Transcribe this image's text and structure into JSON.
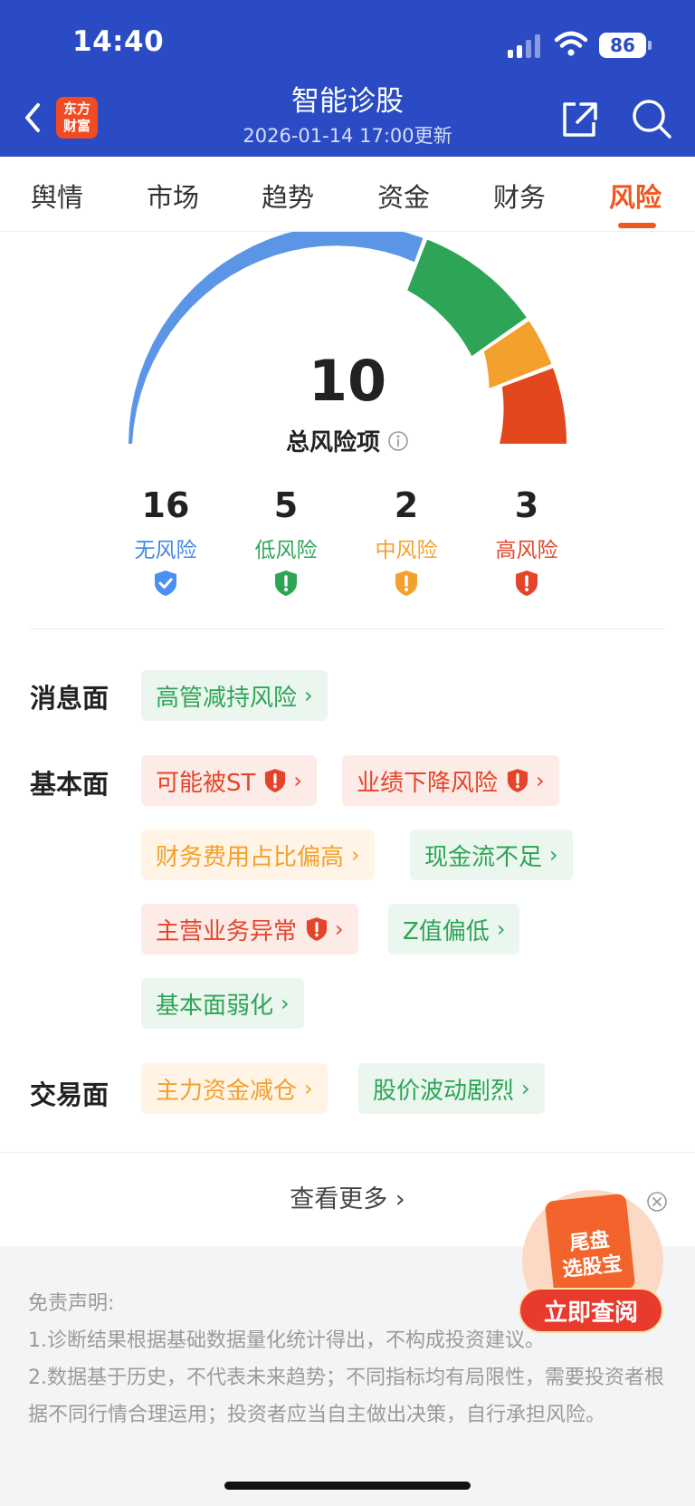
{
  "status_bar": {
    "time": "14:40",
    "battery": "86"
  },
  "header": {
    "logo_line1": "东方",
    "logo_line2": "财富",
    "title": "智能诊股",
    "subtitle": "2026-01-14 17:00更新",
    "icons": {
      "back": "chevron-left-icon",
      "share": "share-icon",
      "search": "search-icon"
    }
  },
  "tabs": [
    {
      "label": "舆情",
      "active": false
    },
    {
      "label": "市场",
      "active": false
    },
    {
      "label": "趋势",
      "active": false
    },
    {
      "label": "资金",
      "active": false
    },
    {
      "label": "财务",
      "active": false
    },
    {
      "label": "风险",
      "active": true
    }
  ],
  "summary": {
    "total": "10",
    "total_label": "总风险项",
    "gauge_segments": [
      {
        "name": "无风险",
        "count": 16,
        "color": "#5b96e6"
      },
      {
        "name": "低风险",
        "count": 5,
        "color": "#2ea556"
      },
      {
        "name": "中风险",
        "count": 2,
        "color": "#f4a02c"
      },
      {
        "name": "高风险",
        "count": 3,
        "color": "#e2471d"
      }
    ],
    "counts": [
      {
        "value": "16",
        "label": "无风险",
        "color": "#3f86e8",
        "icon": "shield-check-icon"
      },
      {
        "value": "5",
        "label": "低风险",
        "color": "#2ea556",
        "icon": "shield-warning-icon"
      },
      {
        "value": "2",
        "label": "中风险",
        "color": "#f4a02c",
        "icon": "shield-warning-icon"
      },
      {
        "value": "3",
        "label": "高风险",
        "color": "#e4452a",
        "icon": "shield-warning-icon"
      }
    ]
  },
  "sections": {
    "news": {
      "label": "消息面",
      "tags": [
        {
          "text": "高管减持风险",
          "level": "low"
        }
      ]
    },
    "fundamental": {
      "label": "基本面",
      "tags": [
        {
          "text": "可能被ST",
          "level": "high",
          "warn": true
        },
        {
          "text": "业绩下降风险",
          "level": "high",
          "warn": true
        },
        {
          "text": "财务费用占比偏高",
          "level": "mid"
        },
        {
          "text": "现金流不足",
          "level": "low"
        },
        {
          "text": "主营业务异常",
          "level": "high",
          "warn": true
        },
        {
          "text": "Z值偏低",
          "level": "low"
        },
        {
          "text": "基本面弱化",
          "level": "low"
        }
      ]
    },
    "trading": {
      "label": "交易面",
      "tags": [
        {
          "text": "主力资金减仓",
          "level": "mid"
        },
        {
          "text": "股价波动剧烈",
          "level": "low"
        }
      ]
    }
  },
  "more_label": "查看更多",
  "disclaimer": {
    "title": "免责声明:",
    "line1": "1.诊断结果根据基础数据量化统计得出，不构成投资建议。",
    "line2": "2.数据基于历史，不代表未来趋势；不同指标均有局限性，需要投资者根据不同行情合理运用；投资者应当自主做出决策，自行承担风险。"
  },
  "ad": {
    "card_line1": "尾盘",
    "card_line2": "选股宝",
    "button": "立即查阅"
  }
}
